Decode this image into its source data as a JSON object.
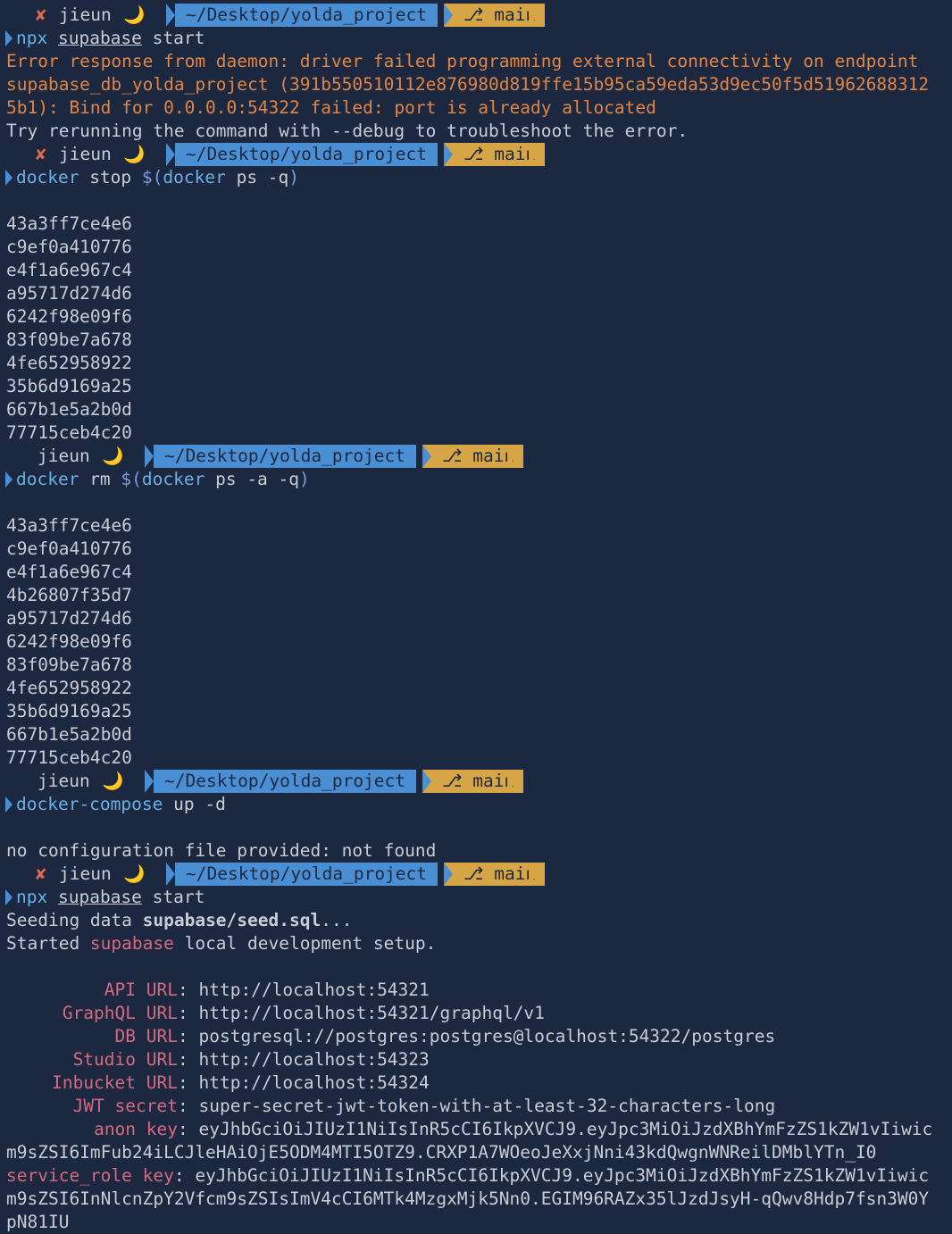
{
  "prompt": {
    "user": "jieun",
    "moon": "🌙",
    "fail_mark": "✘",
    "path": "~/Desktop/yolda_project",
    "branch_icon": "⎇",
    "branch": "main"
  },
  "colors": {
    "background": "#1c2840",
    "path_segment": "#4a8fd4",
    "branch_segment": "#d6a545",
    "error_text": "#e08545",
    "label_text": "#d46a82"
  },
  "cmd1": {
    "c": "npx",
    "p1": "supabase",
    "p2": " start"
  },
  "err1": {
    "l1": "Error response from daemon: driver failed programming external connectivity on endpoint",
    "l2": "supabase_db_yolda_project (391b550510112e876980d819ffe15b95ca59eda53d9ec50f5d51962688312",
    "l3": "5b1): Bind for 0.0.0.0:54322 failed: port is already allocated",
    "l4": "Try rerunning the command with --debug to troubleshoot the error."
  },
  "cmd2": {
    "c": "docker",
    "a": " stop ",
    "s1": "$(",
    "c2": "docker",
    "a2": " ps -q",
    "s2": ")"
  },
  "ids1": [
    "43a3ff7ce4e6",
    "c9ef0a410776",
    "e4f1a6e967c4",
    "a95717d274d6",
    "6242f98e09f6",
    "83f09be7a678",
    "4fe652958922",
    "35b6d9169a25",
    "667b1e5a2b0d",
    "77715ceb4c20"
  ],
  "cmd3": {
    "c": "docker",
    "a": " rm ",
    "s1": "$(",
    "c2": "docker",
    "a2": " ps -a -q",
    "s2": ")"
  },
  "ids2": [
    "43a3ff7ce4e6",
    "c9ef0a410776",
    "e4f1a6e967c4",
    "4b26807f35d7",
    "a95717d274d6",
    "6242f98e09f6",
    "83f09be7a678",
    "4fe652958922",
    "35b6d9169a25",
    "667b1e5a2b0d",
    "77715ceb4c20"
  ],
  "cmd4": {
    "c": "docker-compose",
    "a": " up -d"
  },
  "out4": "no configuration file provided: not found",
  "cmd5": {
    "c": "npx",
    "p1": "supabase",
    "p2": " start"
  },
  "seed": {
    "a": "Seeding data ",
    "b": "supabase/seed.sql",
    "c": "..."
  },
  "started": {
    "a": "Started ",
    "b": "supabase",
    "c": " local development setup."
  },
  "urls": [
    {
      "label": "API",
      "unit": "URL",
      "value": "http://localhost:54321"
    },
    {
      "label": "GraphQL",
      "unit": "URL",
      "value": "http://localhost:54321/graphql/v1"
    },
    {
      "label": "DB",
      "unit": "URL",
      "value": "postgresql://postgres:postgres@localhost:54322/postgres"
    },
    {
      "label": "Studio",
      "unit": "URL",
      "value": "http://localhost:54323"
    },
    {
      "label": "Inbucket",
      "unit": "URL",
      "value": "http://localhost:54324"
    }
  ],
  "jwt": {
    "label": "JWT secret",
    "value": "super-secret-jwt-token-with-at-least-32-characters-long"
  },
  "anon": {
    "label": "anon key",
    "l1": "eyJhbGciOiJIUzI1NiIsInR5cCI6IkpXVCJ9.eyJpc3MiOiJzdXBhYmFzZS1kZW1vIiwic",
    "l2": "m9sZSI6ImFub24iLCJleHAiOjE5ODM4MTI5OTZ9.CRXP1A7WOeoJeXxjNni43kdQwgnWNReilDMblYTn_I0"
  },
  "service": {
    "label": "service_role key",
    "l1": "eyJhbGciOiJIUzI1NiIsInR5cCI6IkpXVCJ9.eyJpc3MiOiJzdXBhYmFzZS1kZW1vIiwic",
    "l2": "m9sZSI6InNlcnZpY2Vfcm9sZSIsImV4cCI6MTk4MzgxMjk5Nn0.EGIM96RAZx35lJzdJsyH-qQwv8Hdp7fsn3W0Y",
    "l3": "pN81IU"
  }
}
